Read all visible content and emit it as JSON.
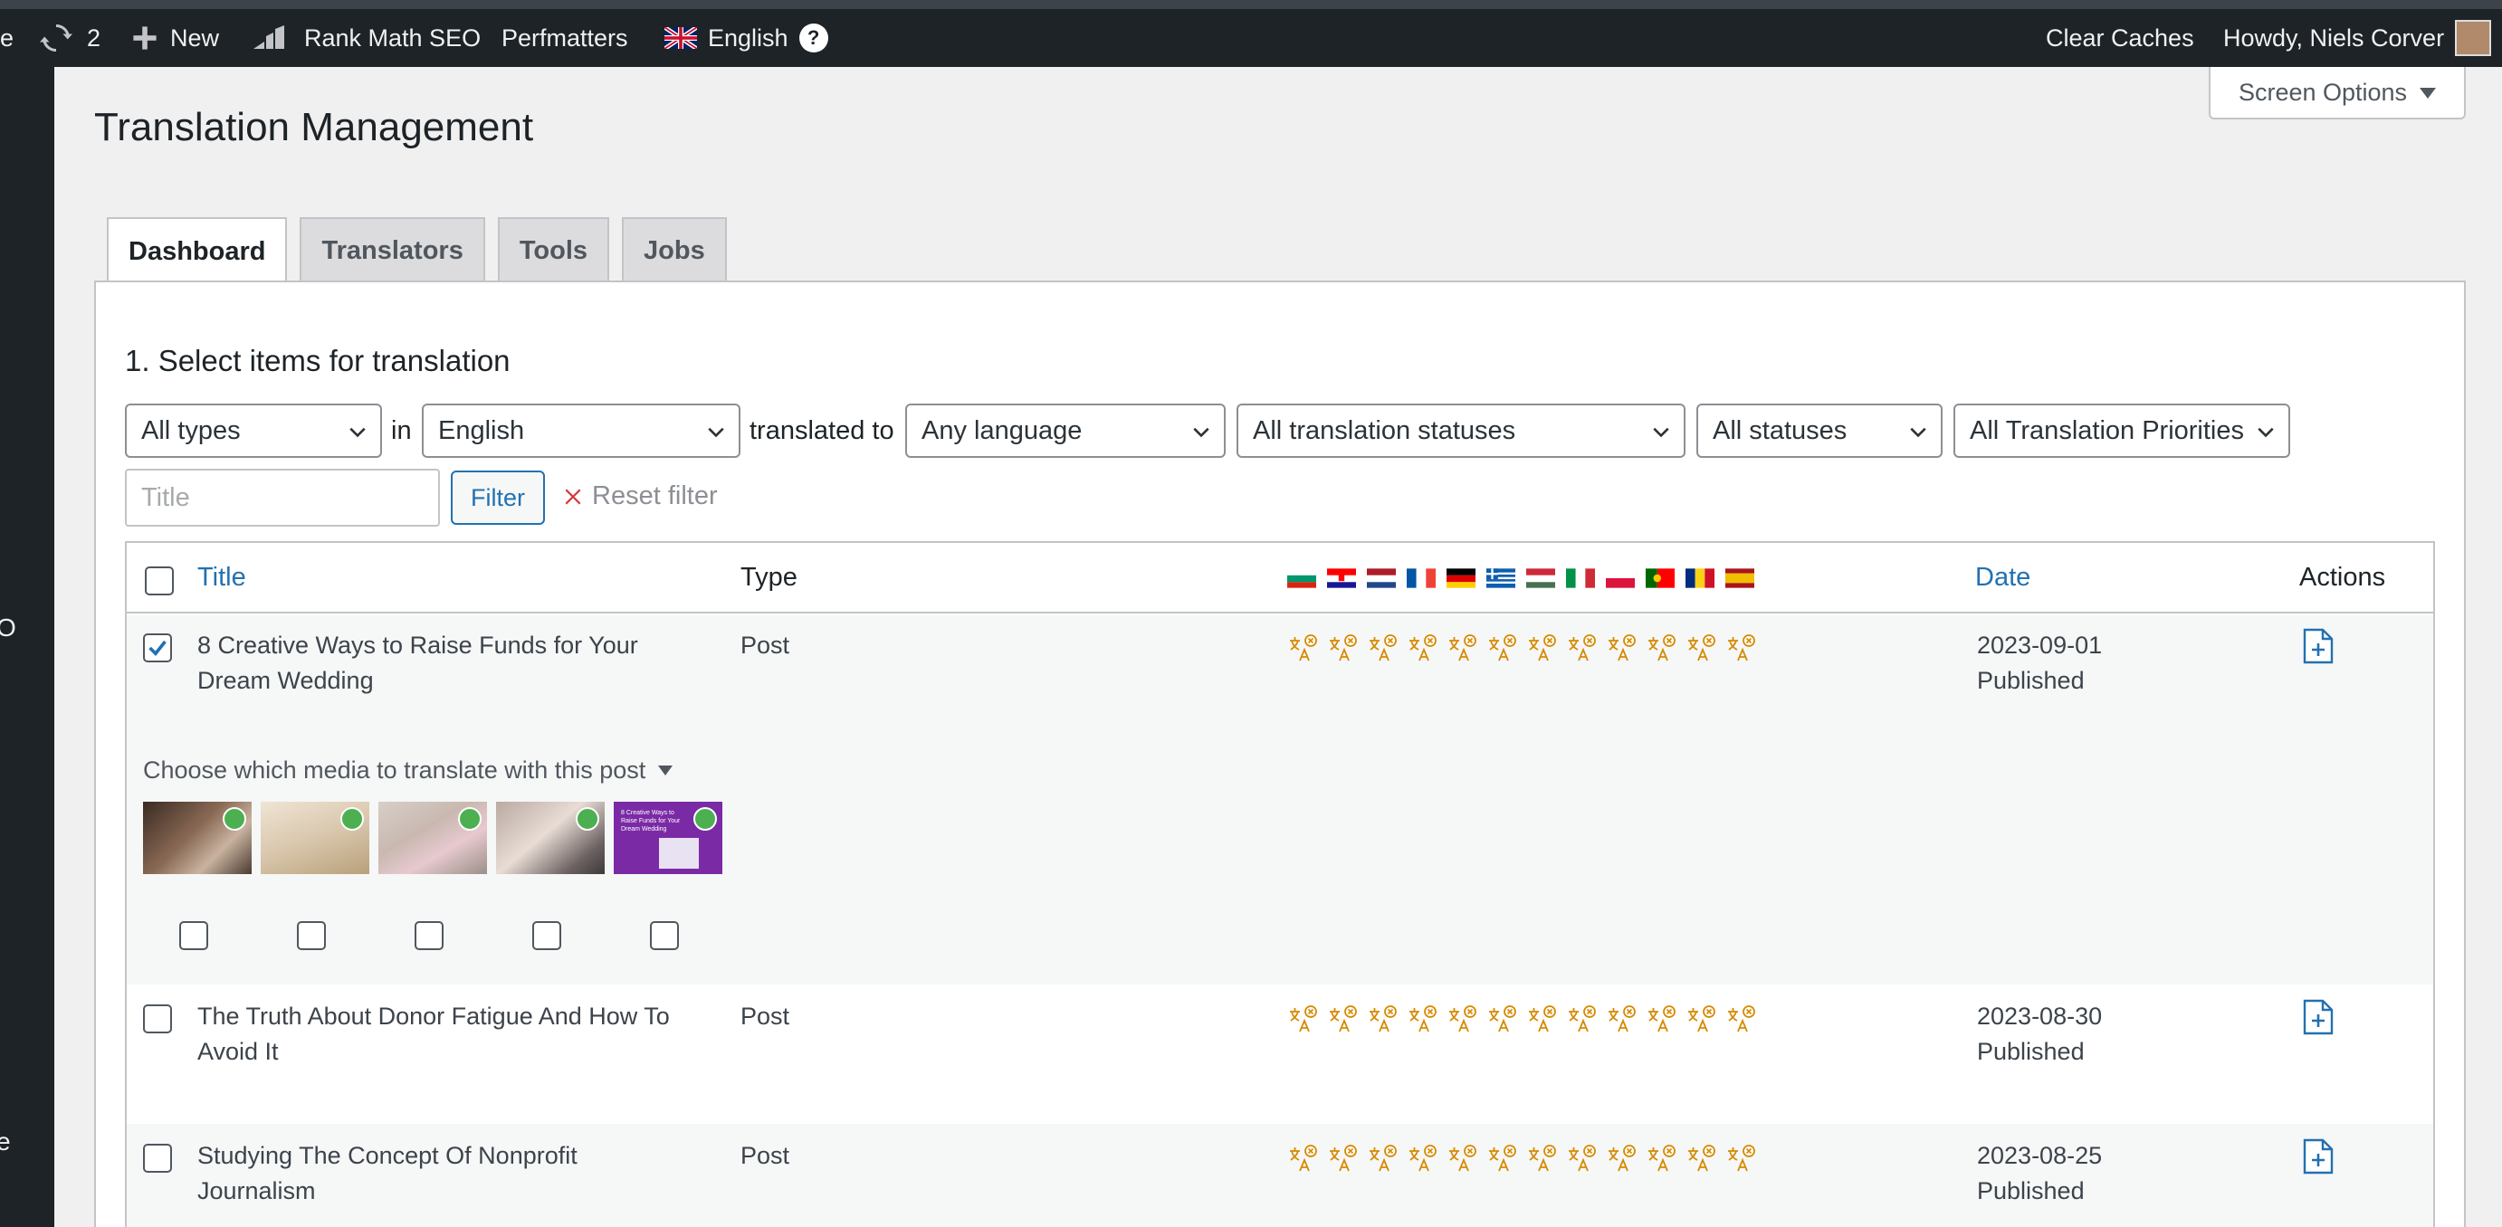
{
  "admin_bar": {
    "partial_left": "e",
    "updates_count": "2",
    "new_label": "New",
    "rank_math": "Rank Math SEO",
    "perfmatters": "Perfmatters",
    "language": "English",
    "help": "?",
    "clear_caches": "Clear Caches",
    "howdy": "Howdy, Niels Corver"
  },
  "sidebar": {
    "glyph_1": "O",
    "glyph_2": "e"
  },
  "screen_options": {
    "label": "Screen Options"
  },
  "page": {
    "title": "Translation Management"
  },
  "tabs": [
    {
      "label": "Dashboard",
      "active": true
    },
    {
      "label": "Translators",
      "active": false
    },
    {
      "label": "Tools",
      "active": false
    },
    {
      "label": "Jobs",
      "active": false
    }
  ],
  "filters": {
    "section_title": "1. Select items for translation",
    "type_select": "All types",
    "in_label": "in",
    "language_select": "English",
    "translated_to_label": "translated to",
    "target_language_select": "Any language",
    "translation_status_select": "All translation statuses",
    "status_select": "All statuses",
    "priority_select": "All Translation Priorities",
    "title_placeholder": "Title",
    "filter_button": "Filter",
    "reset_filter": "Reset filter"
  },
  "table": {
    "columns": {
      "title": "Title",
      "type": "Type",
      "date": "Date",
      "actions": "Actions"
    },
    "language_flags": [
      "bg",
      "hr",
      "nl",
      "fr",
      "de",
      "el",
      "hu",
      "it",
      "pl",
      "pt",
      "ro",
      "es"
    ],
    "rows": [
      {
        "title_line1": "8 Creative Ways to Raise Funds for Your",
        "title_line2": "Dream Wedding",
        "type": "Post",
        "date": "2023-09-01",
        "status": "Published",
        "checked": true
      },
      {
        "title_line1": "The Truth About Donor Fatigue And How To",
        "title_line2": "Avoid It",
        "type": "Post",
        "date": "2023-08-30",
        "status": "Published",
        "checked": false
      },
      {
        "title_line1": "Studying The Concept Of Nonprofit",
        "title_line2": "Journalism",
        "type": "Post",
        "date": "2023-08-25",
        "status": "Published",
        "checked": false
      }
    ],
    "media": {
      "label": "Choose which media to translate with this post",
      "thumb5_text": "8 Creative Ways to Raise Funds for Your Dream Wedding"
    }
  },
  "colors": {
    "admin_bar": "#1d2327",
    "link": "#2271b1",
    "status_icon": "#d68a00",
    "badge": "#4caf50",
    "thumb5_bg": "#7b2aa6"
  }
}
